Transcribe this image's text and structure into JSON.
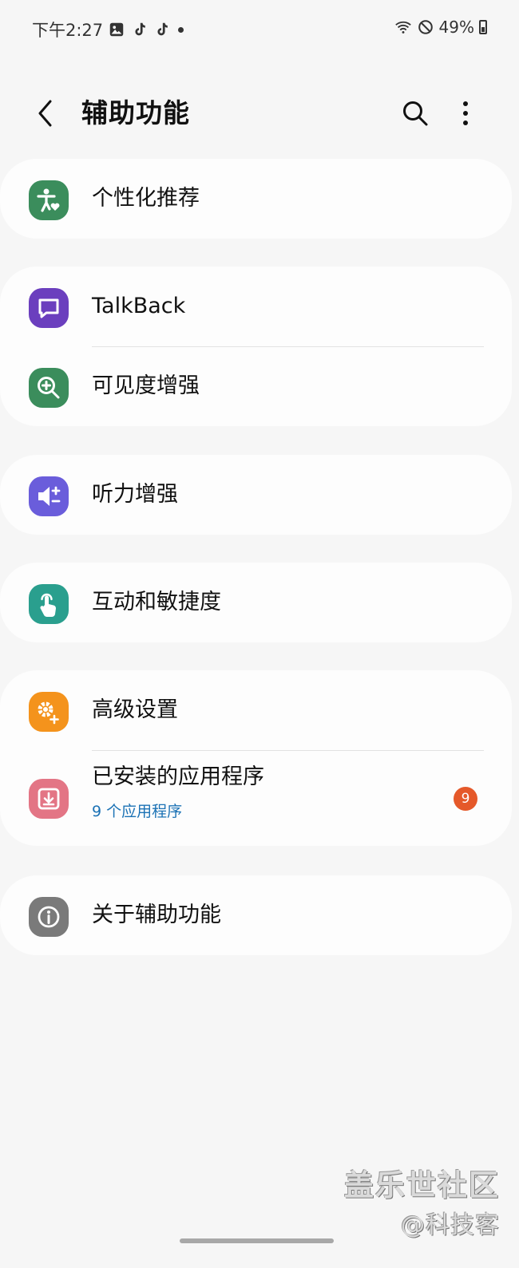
{
  "status_bar": {
    "time": "下午2:27",
    "battery": "49%",
    "notification_icons": [
      "gallery-icon",
      "tiktok-icon",
      "tiktok-icon",
      "dot-icon"
    ],
    "right_icons": [
      "wifi-icon",
      "do-not-disturb-icon",
      "battery-icon"
    ]
  },
  "header": {
    "title": "辅助功能",
    "back_icon": "chevron-left-icon",
    "search_icon": "search-icon",
    "more_icon": "more-vertical-icon"
  },
  "groups": [
    {
      "items": [
        {
          "label": "个性化推荐",
          "icon": "accessibility-heart-icon",
          "color": "#3b8d5c"
        }
      ]
    },
    {
      "items": [
        {
          "label": "TalkBack",
          "icon": "chat-bubble-icon",
          "color": "#6b3fbe"
        },
        {
          "label": "可见度增强",
          "icon": "zoom-in-icon",
          "color": "#3b8d5c"
        }
      ]
    },
    {
      "items": [
        {
          "label": "听力增强",
          "icon": "volume-adjust-icon",
          "color": "#6a5ddb"
        }
      ]
    },
    {
      "items": [
        {
          "label": "互动和敏捷度",
          "icon": "touch-hand-icon",
          "color": "#2a9f8e"
        }
      ]
    },
    {
      "items": [
        {
          "label": "高级设置",
          "icon": "gear-plus-icon",
          "color": "#f4931c"
        },
        {
          "label": "已安装的应用程序",
          "sub": "9 个应用程序",
          "badge": "9",
          "icon": "download-icon",
          "color": "#e37585"
        }
      ]
    },
    {
      "items": [
        {
          "label": "关于辅助功能",
          "icon": "info-icon",
          "color": "#7a7a7a"
        }
      ]
    }
  ],
  "colors": {
    "badge": "#e5592a",
    "subtext": "#1b72b5",
    "background": "#f6f6f6"
  },
  "watermark": {
    "line1": "盖乐世社区",
    "line2": "@科技客"
  }
}
